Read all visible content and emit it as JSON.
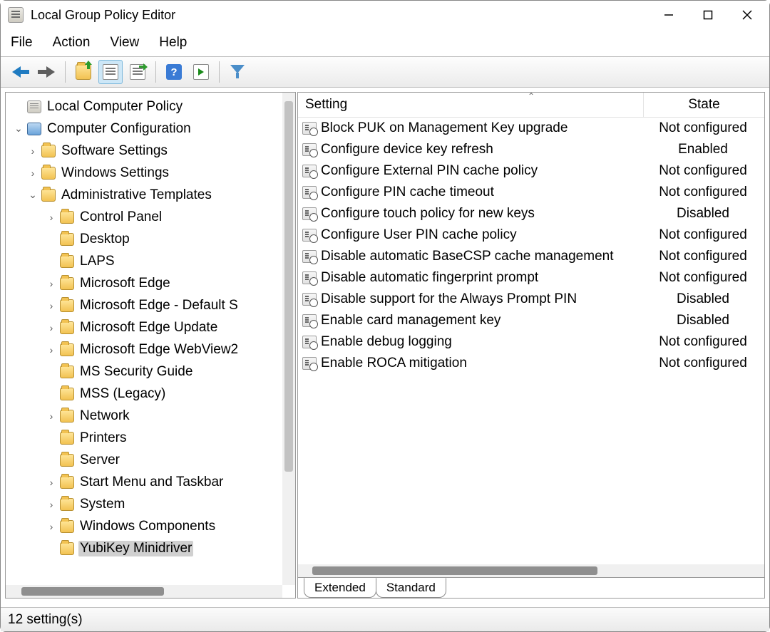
{
  "window": {
    "title": "Local Group Policy Editor"
  },
  "menu": {
    "file": "File",
    "action": "Action",
    "view": "View",
    "help": "Help"
  },
  "tree": {
    "root": "Local Computer Policy",
    "computer_config": "Computer Configuration",
    "software_settings": "Software Settings",
    "windows_settings": "Windows Settings",
    "admin_templates": "Administrative Templates",
    "control_panel": "Control Panel",
    "desktop": "Desktop",
    "laps": "LAPS",
    "ms_edge": "Microsoft Edge",
    "ms_edge_default": "Microsoft Edge - Default S",
    "ms_edge_update": "Microsoft Edge Update",
    "ms_edge_webview": "Microsoft Edge WebView2",
    "ms_security_guide": "MS Security Guide",
    "mss_legacy": "MSS (Legacy)",
    "network": "Network",
    "printers": "Printers",
    "server": "Server",
    "start_menu": "Start Menu and Taskbar",
    "system": "System",
    "win_components": "Windows Components",
    "yubikey": "YubiKey Minidriver"
  },
  "columns": {
    "setting": "Setting",
    "state": "State"
  },
  "settings": [
    {
      "name": "Block PUK on Management Key upgrade",
      "state": "Not configured"
    },
    {
      "name": "Configure device key refresh",
      "state": "Enabled"
    },
    {
      "name": "Configure External PIN cache policy",
      "state": "Not configured"
    },
    {
      "name": "Configure PIN cache timeout",
      "state": "Not configured"
    },
    {
      "name": "Configure touch policy for new keys",
      "state": "Disabled"
    },
    {
      "name": "Configure User PIN cache policy",
      "state": "Not configured"
    },
    {
      "name": "Disable automatic BaseCSP cache management",
      "state": "Not configured"
    },
    {
      "name": "Disable automatic fingerprint prompt",
      "state": "Not configured"
    },
    {
      "name": "Disable support for the Always Prompt PIN",
      "state": "Disabled"
    },
    {
      "name": "Enable card management key",
      "state": "Disabled"
    },
    {
      "name": "Enable debug logging",
      "state": "Not configured"
    },
    {
      "name": "Enable ROCA mitigation",
      "state": "Not configured"
    }
  ],
  "tabs": {
    "extended": "Extended",
    "standard": "Standard"
  },
  "status": "12 setting(s)"
}
